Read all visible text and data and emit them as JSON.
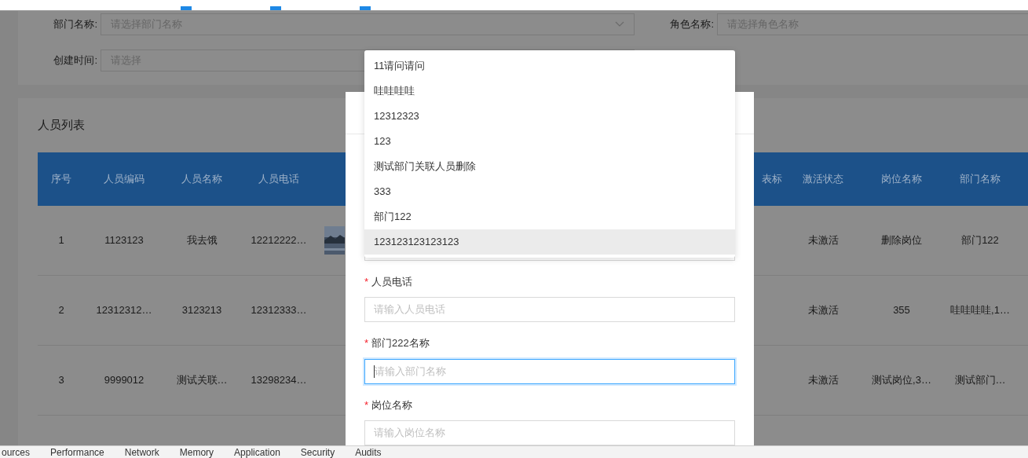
{
  "search_form": {
    "fields": [
      {
        "label": "部门名称:",
        "placeholder": "请选择部门名称",
        "kind": "select"
      },
      {
        "label": "角色名称:",
        "placeholder": "请选择角色名称",
        "kind": "input"
      },
      {
        "label": "创建时间:",
        "placeholder": "请选择",
        "kind": "input"
      }
    ]
  },
  "table": {
    "title": "人员列表",
    "columns": [
      "序号",
      "人员编码",
      "人员名称",
      "人员电话",
      "表标",
      "激活状态",
      "岗位名称",
      "部门名称"
    ],
    "rows": [
      {
        "cells": [
          "1",
          "1123123",
          "我去饿",
          "12212222…",
          "",
          "未激活",
          "删除岗位",
          "部门122"
        ]
      },
      {
        "cells": [
          "2",
          "12312312…",
          "3123213",
          "12312333…",
          "",
          "未激活",
          "355",
          "哇哇哇哇,1…"
        ]
      },
      {
        "cells": [
          "3",
          "9999012",
          "测试关联…",
          "13298234…",
          "",
          "未激活",
          "测试岗位,3…",
          "测试部门…"
        ]
      }
    ]
  },
  "dialog": {
    "fields": [
      {
        "label": "人员电话",
        "required_mark": "*",
        "placeholder": "请输入人员电话",
        "focused": false
      },
      {
        "label": "部门222名称",
        "required_mark": "*",
        "placeholder": "请输入部门名称",
        "focused": true
      },
      {
        "label": "岗位名称",
        "required_mark": "*",
        "placeholder": "请输入岗位名称",
        "focused": false
      }
    ]
  },
  "dropdown": {
    "options": [
      {
        "label": "11请问请问",
        "selected": false
      },
      {
        "label": "哇哇哇哇",
        "selected": false
      },
      {
        "label": "12312323",
        "selected": false
      },
      {
        "label": "123",
        "selected": false
      },
      {
        "label": "测试部门关联人员删除",
        "selected": false
      },
      {
        "label": "333",
        "selected": false
      },
      {
        "label": "部门122",
        "selected": false
      },
      {
        "label": "123123123123123",
        "selected": true
      }
    ]
  },
  "devtools_tabs": [
    "ources",
    "Performance",
    "Network",
    "Memory",
    "Application",
    "Security",
    "Audits"
  ]
}
